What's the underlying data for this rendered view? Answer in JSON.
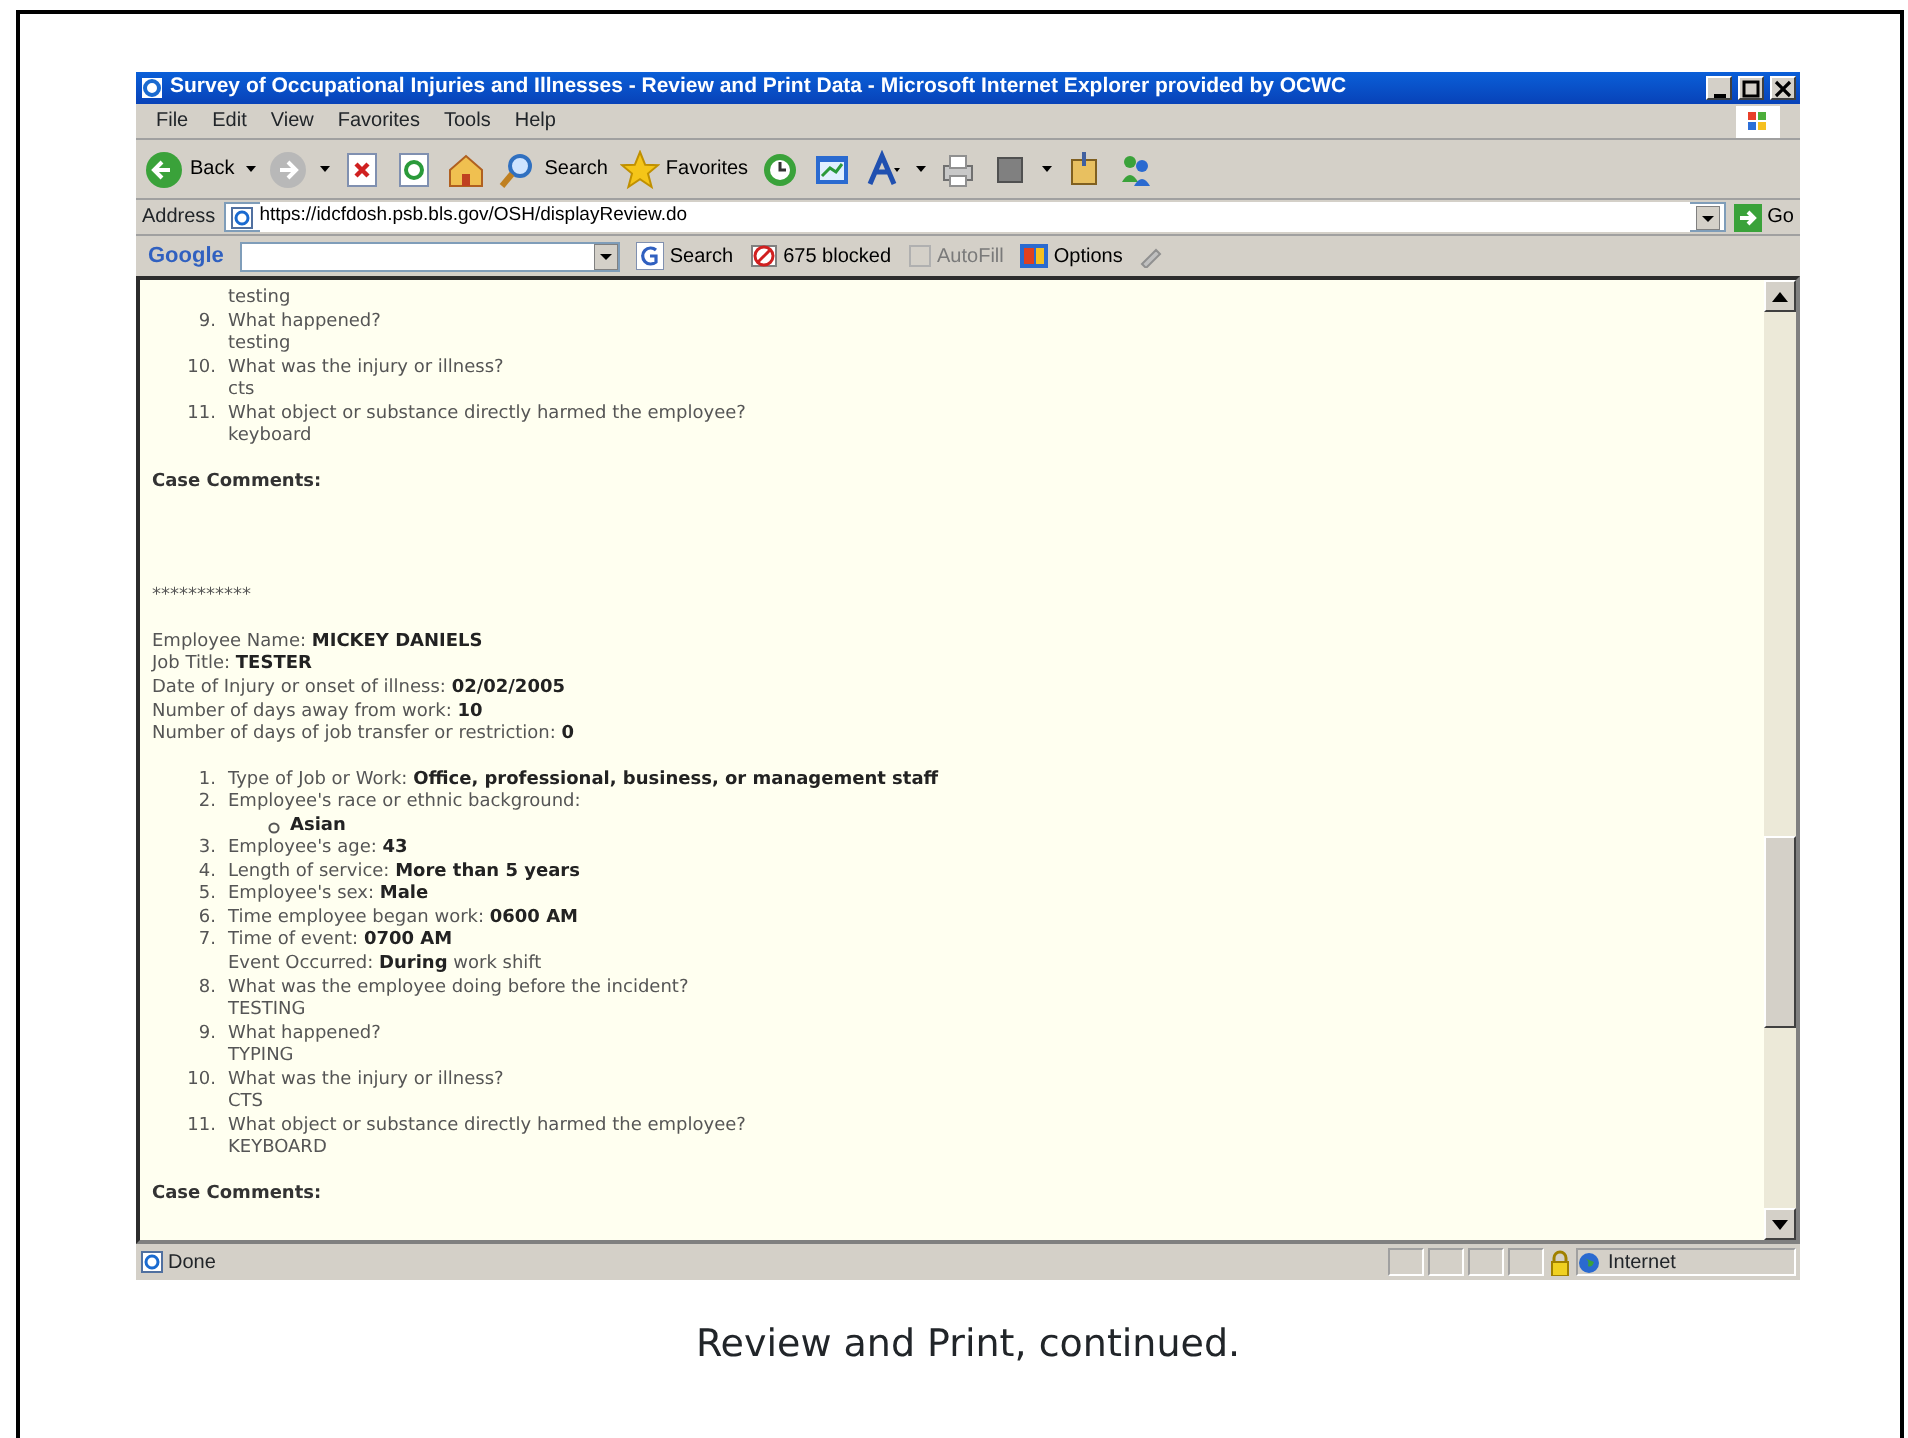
{
  "window": {
    "title": "Survey of Occupational Injuries and Illnesses - Review and Print Data - Microsoft Internet Explorer provided by OCWC"
  },
  "menu": [
    "File",
    "Edit",
    "View",
    "Favorites",
    "Tools",
    "Help"
  ],
  "toolbar": [
    {
      "kind": "back",
      "label": "Back"
    },
    {
      "kind": "forward"
    },
    {
      "kind": "stop"
    },
    {
      "kind": "refresh"
    },
    {
      "kind": "home"
    },
    {
      "kind": "search",
      "label": "Search"
    },
    {
      "kind": "favorites",
      "label": "Favorites"
    },
    {
      "kind": "history"
    },
    {
      "kind": "edit"
    },
    {
      "kind": "font"
    },
    {
      "kind": "print"
    },
    {
      "kind": "box"
    },
    {
      "kind": "tool"
    },
    {
      "kind": "messenger"
    }
  ],
  "address_bar": {
    "label": "Address",
    "url": "https://idcfdosh.psb.bls.gov/OSH/displayReview.do",
    "go": "Go"
  },
  "google_bar": {
    "logo": "Google",
    "search": "Search",
    "blocked": "675 blocked",
    "autofill": {
      "label": "AutoFill",
      "disabled": true
    },
    "options": "Options"
  },
  "content": {
    "first_case": {
      "leading_answer": "testing",
      "questions": [
        {
          "number": "9.",
          "text": "What happened?",
          "answer": "testing"
        },
        {
          "number": "10.",
          "text": "What was the injury or illness?",
          "answer": "cts"
        },
        {
          "number": "11.",
          "text": "What object or substance directly harmed the employee?",
          "answer": "keyboard"
        }
      ],
      "comments_label": "Case Comments:"
    },
    "separator": "***********",
    "second_case": {
      "fields": [
        "Employee Name: **MICKEY DANIELS**",
        "Job Title: **TESTER**",
        "Date of Injury or onset of illness: **02/02/2005**",
        "Number of days away from work: **10**",
        "Number of days of job transfer or restriction: **0**"
      ],
      "questions": [
        {
          "number": "1.",
          "text": "Type of Job or Work: **Office, professional, business, or management staff**"
        },
        {
          "number": "2.",
          "text": "Employee's race or ethnic background:",
          "bullets": [
            "Asian"
          ]
        },
        {
          "number": "3.",
          "text": "Employee's age: **43**"
        },
        {
          "number": "4.",
          "text": "Length of service: **More than 5 years**"
        },
        {
          "number": "5.",
          "text": "Employee's sex: **Male**"
        },
        {
          "number": "6.",
          "text": "Time employee began work: **0600 AM**"
        },
        {
          "number": "7.",
          "text": "Time of event: **0700 AM**",
          "note": "Event Occurred: **During** work shift"
        },
        {
          "number": "8.",
          "text": "What was the employee doing before the incident?",
          "answer": "TESTING"
        },
        {
          "number": "9.",
          "text": "What happened?",
          "answer": "TYPING"
        },
        {
          "number": "10.",
          "text": "What was the injury or illness?",
          "answer": "CTS"
        },
        {
          "number": "11.",
          "text": "What object or substance directly harmed the employee?",
          "answer": "KEYBOARD"
        }
      ],
      "comments_label": "Case Comments:"
    }
  },
  "status_bar": {
    "text": "Done",
    "zone": "Internet"
  },
  "caption": "Review and Print, continued."
}
